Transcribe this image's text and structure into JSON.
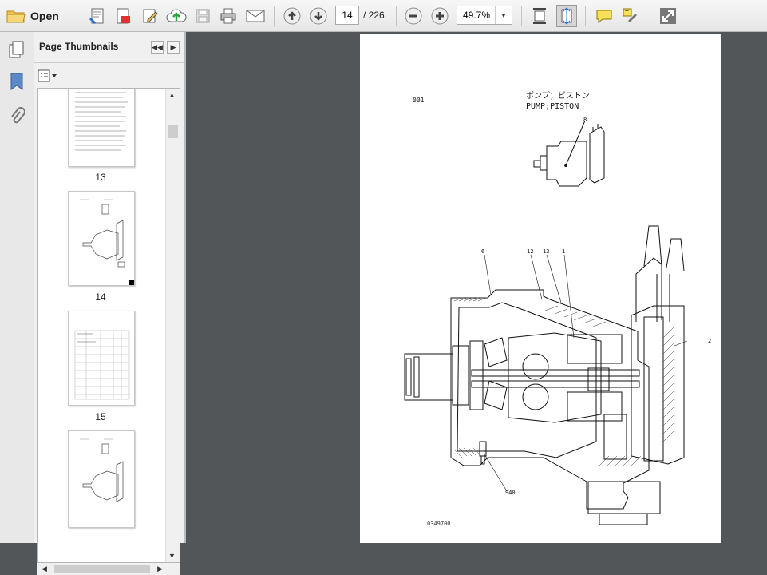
{
  "toolbar": {
    "open_label": "Open",
    "current_page": "14",
    "page_count": "/ 226",
    "zoom": "49.7%"
  },
  "panel": {
    "title": "Page Thumbnails",
    "thumbnails": [
      {
        "label": "13"
      },
      {
        "label": "14"
      },
      {
        "label": "15"
      },
      {
        "label": ""
      }
    ]
  },
  "document": {
    "header_jp": "ポンプ；ピストン",
    "title": "PUMP;PISTON",
    "page_code": "001",
    "footer_code": "0349700",
    "callouts": [
      "8",
      "6",
      "12",
      "13",
      "1",
      "2",
      "940"
    ]
  },
  "colors": {
    "app_background": "#525659",
    "toolbar": "#eeeeee",
    "panel": "#f0f0f0",
    "page": "#ffffff",
    "selected_thumb_marker": "#000000"
  }
}
